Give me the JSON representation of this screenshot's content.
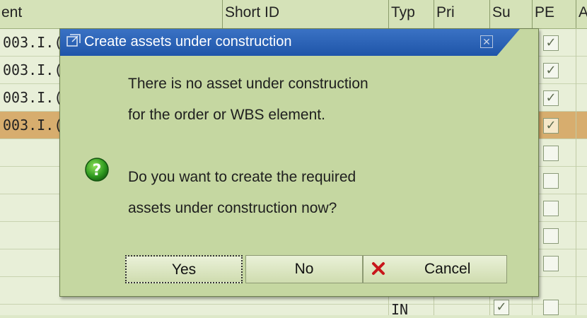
{
  "table": {
    "columns": [
      "ent",
      "Short ID",
      "Typ",
      "Pri",
      "Su",
      "PE",
      "A"
    ],
    "rows": [
      {
        "element": "003.I.("
      },
      {
        "element": "003.I.("
      },
      {
        "element": "003.I.("
      },
      {
        "element": "003.I.("
      }
    ],
    "last_row_typ": "IN"
  },
  "dialog": {
    "title": "Create assets under construction",
    "message_line1": "There is no asset under construction",
    "message_line2": "for the order or WBS element.",
    "question_line1": "Do you want to create the required",
    "question_line2": "assets under construction now?",
    "buttons": {
      "yes": "Yes",
      "no": "No",
      "cancel": "Cancel"
    },
    "icons": {
      "title": "window-icon",
      "question": "question-icon",
      "cancel": "cancel-x-icon",
      "close": "close-icon"
    },
    "colors": {
      "titlebar": "#2a62b8",
      "body": "#c5d7a1",
      "selected_row": "#d7ad6e"
    }
  }
}
